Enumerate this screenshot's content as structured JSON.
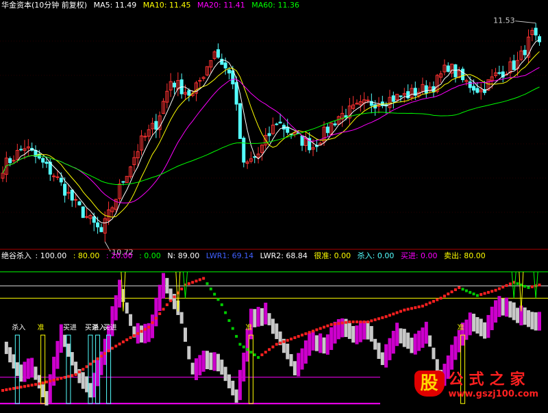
{
  "chart_data": [
    {
      "type": "candlestick",
      "title": "华金资本(10分钟 前复权)",
      "ma_labels": [
        {
          "name": "MA5",
          "value": "11.49",
          "color": "#ffffff"
        },
        {
          "name": "MA10",
          "value": "11.45",
          "color": "#ffff00"
        },
        {
          "name": "MA20",
          "value": "11.41",
          "color": "#ff00ff"
        },
        {
          "name": "MA60",
          "value": "11.36",
          "color": "#00ff00"
        }
      ],
      "max_label": "11.53",
      "min_label": "10.72",
      "ylim": [
        10.68,
        11.62
      ],
      "up_color": "#ff3232",
      "down_color": "#54ffff",
      "anchors": [
        [
          0,
          11.0
        ],
        [
          6,
          11.08
        ],
        [
          14,
          10.97
        ],
        [
          20,
          10.85
        ],
        [
          27,
          10.74
        ],
        [
          33,
          10.95
        ],
        [
          38,
          11.1
        ],
        [
          42,
          11.17
        ],
        [
          46,
          11.34
        ],
        [
          52,
          11.28
        ],
        [
          58,
          11.46
        ],
        [
          63,
          11.34
        ],
        [
          66,
          11.0
        ],
        [
          70,
          11.05
        ],
        [
          75,
          11.18
        ],
        [
          80,
          11.12
        ],
        [
          85,
          11.08
        ],
        [
          92,
          11.2
        ],
        [
          100,
          11.25
        ],
        [
          110,
          11.28
        ],
        [
          118,
          11.32
        ],
        [
          122,
          11.4
        ],
        [
          126,
          11.34
        ],
        [
          131,
          11.3
        ],
        [
          135,
          11.36
        ],
        [
          141,
          11.41
        ],
        [
          145,
          11.52
        ],
        [
          147,
          11.47
        ]
      ]
    },
    {
      "type": "indicator",
      "header": {
        "name": "绝谷杀入",
        "v1": ": 100.00",
        "v2": ": 80.00",
        "v3": ": 20.00",
        "v4": ": 0.00",
        "n": "N: 89.00",
        "lwr1": "LWR1: 69.14",
        "lwr2": "LWR2: 68.84",
        "hen": "很准: 0.00",
        "sha": "杀入: 0.00",
        "mai": "买进: 0.00",
        "chu": "卖出: 80.00"
      },
      "levels": {
        "upper": 100,
        "mid_upper": 80,
        "mid_lower": 20,
        "zero": 0
      },
      "signals": [
        {
          "text": "杀入",
          "color": "#ffffff"
        },
        {
          "text": "准",
          "color": "#ffff00"
        },
        {
          "text": "买进",
          "color": "#ffffff"
        },
        {
          "text": "买进",
          "color": "#ffffff"
        },
        {
          "text": "杀入",
          "color": "#ffffff"
        },
        {
          "text": "买进",
          "color": "#ffffff"
        },
        {
          "text": "准",
          "color": "#ffff00"
        },
        {
          "text": "准",
          "color": "#ffff00"
        }
      ],
      "lwr_anchors": [
        [
          0,
          55
        ],
        [
          4,
          30
        ],
        [
          8,
          35
        ],
        [
          12,
          10
        ],
        [
          16,
          60
        ],
        [
          20,
          30
        ],
        [
          24,
          15
        ],
        [
          28,
          50
        ],
        [
          32,
          95
        ],
        [
          36,
          60
        ],
        [
          40,
          60
        ],
        [
          44,
          98
        ],
        [
          48,
          80
        ],
        [
          52,
          30
        ],
        [
          56,
          42
        ],
        [
          60,
          35
        ],
        [
          64,
          10
        ],
        [
          68,
          70
        ],
        [
          72,
          75
        ],
        [
          76,
          55
        ],
        [
          80,
          32
        ],
        [
          84,
          55
        ],
        [
          88,
          50
        ],
        [
          92,
          66
        ],
        [
          96,
          60
        ],
        [
          100,
          64
        ],
        [
          104,
          38
        ],
        [
          108,
          60
        ],
        [
          112,
          52
        ],
        [
          116,
          62
        ],
        [
          120,
          25
        ],
        [
          124,
          50
        ],
        [
          128,
          70
        ],
        [
          132,
          62
        ],
        [
          136,
          82
        ],
        [
          140,
          75
        ],
        [
          144,
          70
        ],
        [
          147,
          68
        ]
      ],
      "trend_anchors": [
        [
          0,
          10
        ],
        [
          10,
          15
        ],
        [
          20,
          22
        ],
        [
          30,
          42
        ],
        [
          40,
          58
        ],
        [
          45,
          75
        ],
        [
          50,
          90
        ],
        [
          55,
          95
        ],
        [
          60,
          75
        ],
        [
          65,
          45
        ],
        [
          70,
          35
        ],
        [
          75,
          45
        ],
        [
          80,
          50
        ],
        [
          85,
          55
        ],
        [
          90,
          60
        ],
        [
          95,
          62
        ],
        [
          100,
          62
        ],
        [
          105,
          66
        ],
        [
          110,
          71
        ],
        [
          115,
          74
        ],
        [
          120,
          80
        ],
        [
          125,
          88
        ],
        [
          130,
          82
        ],
        [
          135,
          86
        ],
        [
          140,
          92
        ],
        [
          144,
          88
        ],
        [
          147,
          90
        ]
      ]
    }
  ],
  "watermark": {
    "logo_char": "股",
    "title": "公式之家",
    "url": "www.gszj100.com"
  }
}
